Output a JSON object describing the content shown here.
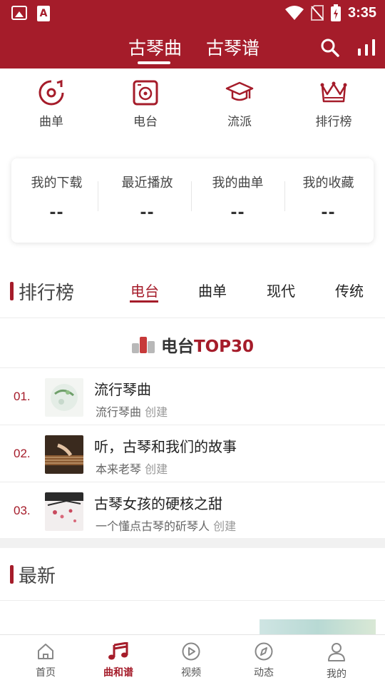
{
  "status_bar": {
    "time": "3:35",
    "left_icons": [
      "image-icon",
      "text-a-icon"
    ],
    "right_icons": [
      "wifi-icon",
      "no-sim-icon",
      "battery-icon"
    ]
  },
  "header": {
    "tabs": [
      {
        "label": "古琴曲",
        "active": true
      },
      {
        "label": "古琴谱",
        "active": false
      }
    ],
    "actions": [
      "search-icon",
      "chart-bars-icon"
    ],
    "color": "#a51c2a"
  },
  "categories": [
    {
      "label": "曲单",
      "icon": "disc-icon"
    },
    {
      "label": "电台",
      "icon": "radio-icon"
    },
    {
      "label": "流派",
      "icon": "graduation-cap-icon"
    },
    {
      "label": "排行榜",
      "icon": "crown-icon"
    }
  ],
  "stats": [
    {
      "label": "我的下载",
      "value": "--"
    },
    {
      "label": "最近播放",
      "value": "--"
    },
    {
      "label": "我的曲单",
      "value": "--"
    },
    {
      "label": "我的收藏",
      "value": "--"
    }
  ],
  "ranking": {
    "title": "排行榜",
    "tabs": [
      {
        "label": "电台",
        "active": true
      },
      {
        "label": "曲单",
        "active": false
      },
      {
        "label": "现代",
        "active": false
      },
      {
        "label": "传统",
        "active": false
      }
    ],
    "banner": {
      "prefix": "电台",
      "highlight": "TOP30",
      "icon": "podium-icon"
    },
    "items": [
      {
        "num": "01.",
        "title": "流行琴曲",
        "author": "流行琴曲",
        "suffix": "创建"
      },
      {
        "num": "02.",
        "title": "听，古琴和我们的故事",
        "author": "本来老琴",
        "suffix": "创建"
      },
      {
        "num": "03.",
        "title": "古琴女孩的硬核之甜",
        "author": "一个懂点古琴的斫琴人",
        "suffix": "创建"
      }
    ]
  },
  "latest": {
    "title": "最新"
  },
  "bottom_nav": [
    {
      "label": "首页",
      "icon": "home-icon",
      "active": false
    },
    {
      "label": "曲和谱",
      "icon": "music-note-icon",
      "active": true
    },
    {
      "label": "视频",
      "icon": "play-icon",
      "active": false
    },
    {
      "label": "动态",
      "icon": "compass-icon",
      "active": false
    },
    {
      "label": "我的",
      "icon": "person-icon",
      "active": false
    }
  ]
}
